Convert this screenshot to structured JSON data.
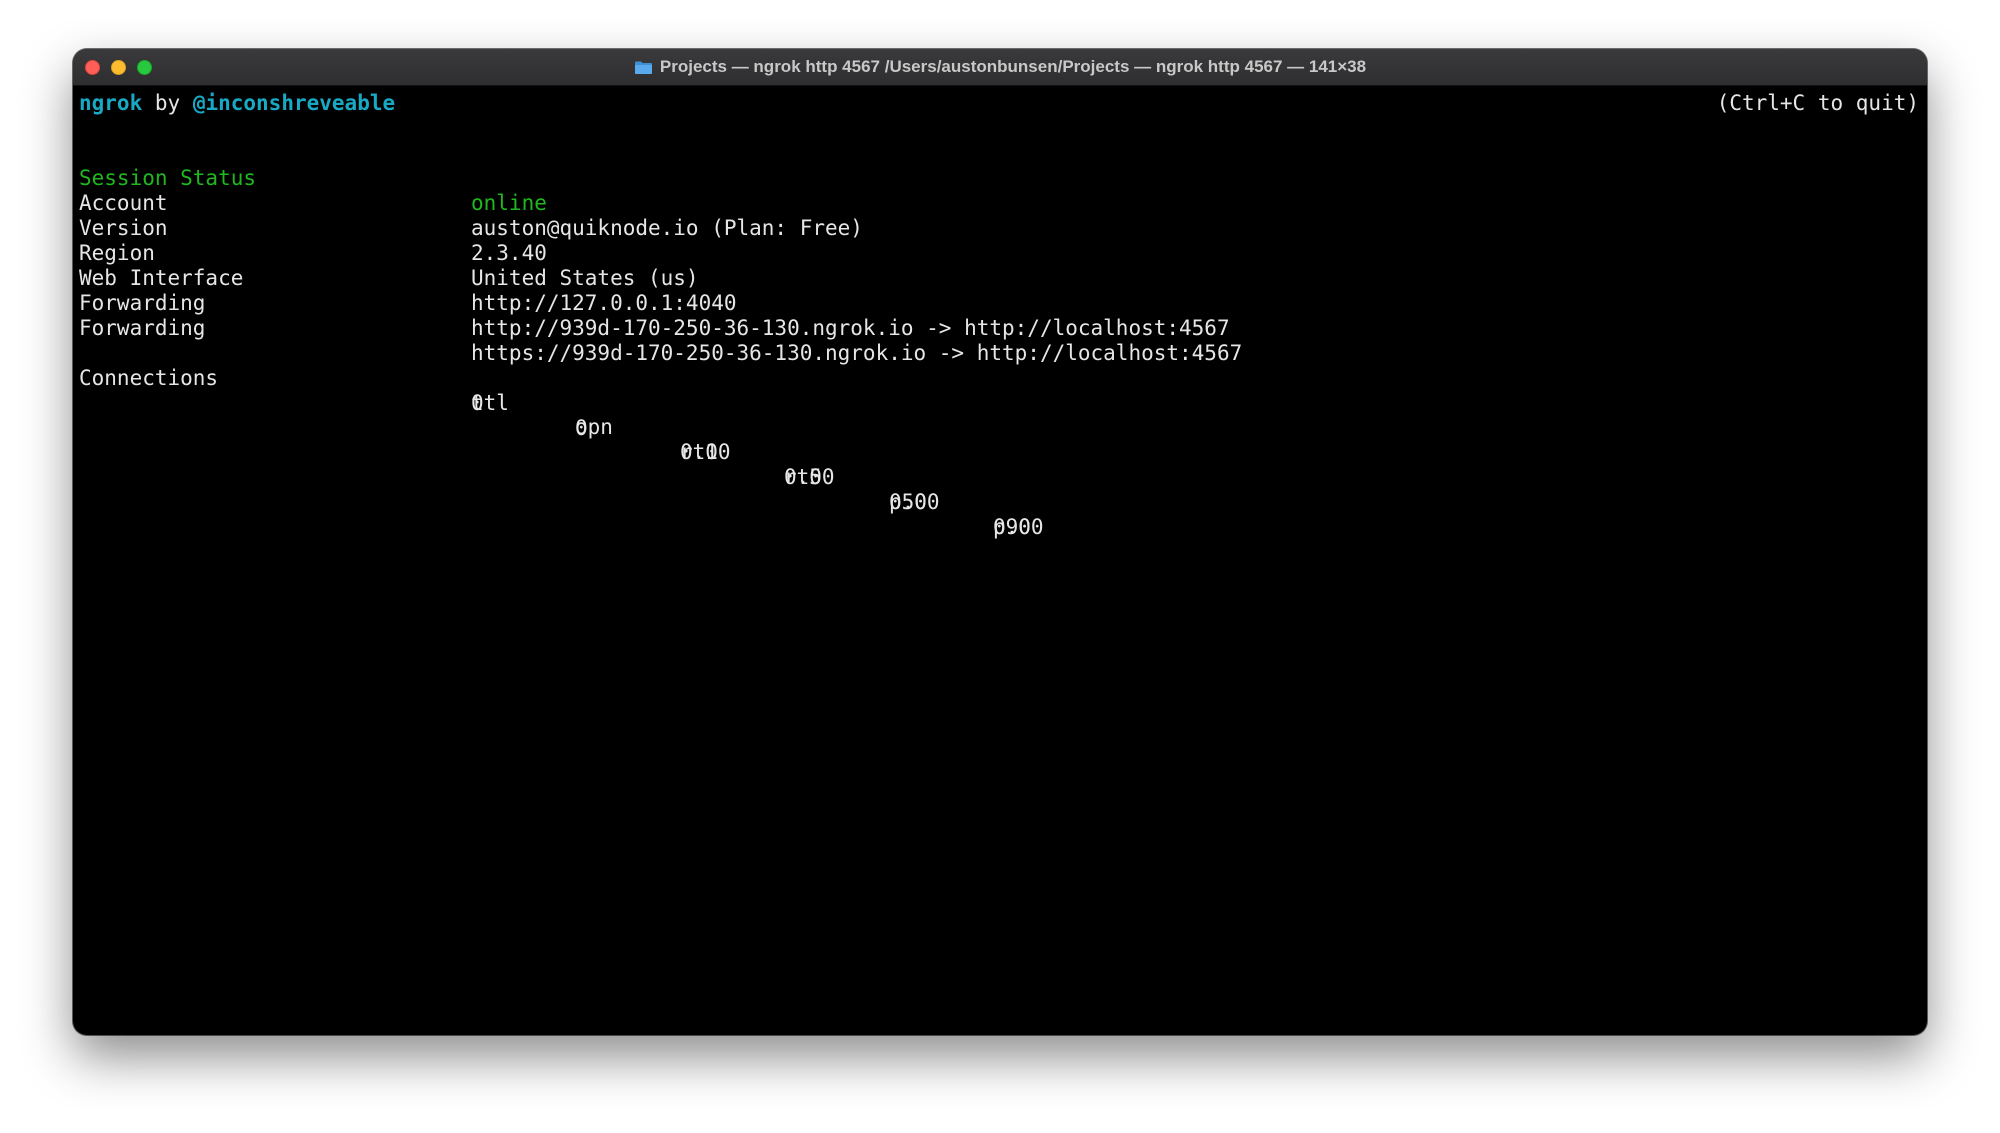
{
  "window": {
    "title": "Projects — ngrok http 4567 /Users/austonbunsen/Projects — ngrok http 4567 — 141×38",
    "title_icon": "folder-icon"
  },
  "header": {
    "brand": "ngrok",
    "by": "by",
    "author": "@inconshreveable",
    "quit_hint": "(Ctrl+C to quit)"
  },
  "session": {
    "status_label": "Session Status",
    "status_value": "online",
    "account_label": "Account",
    "account_value": "auston@quiknode.io (Plan: Free)",
    "version_label": "Version",
    "version_value": "2.3.40",
    "region_label": "Region",
    "region_value": "United States (us)",
    "web_label": "Web Interface",
    "web_value": "http://127.0.0.1:4040",
    "forwarding": [
      {
        "label": "Forwarding",
        "value": "http://939d-170-250-36-130.ngrok.io -> http://localhost:4567"
      },
      {
        "label": "Forwarding",
        "value": "https://939d-170-250-36-130.ngrok.io -> http://localhost:4567"
      }
    ]
  },
  "connections": {
    "label": "Connections",
    "headers": [
      "ttl",
      "opn",
      "rt1",
      "rt5",
      "p50",
      "p90"
    ],
    "values": [
      "0",
      "0",
      "0.00",
      "0.00",
      "0.00",
      "0.00"
    ]
  },
  "colors": {
    "accent_cyan": "#18a9c4",
    "status_green": "#1fb81f",
    "text": "#e6e6e6",
    "background": "#000000"
  }
}
